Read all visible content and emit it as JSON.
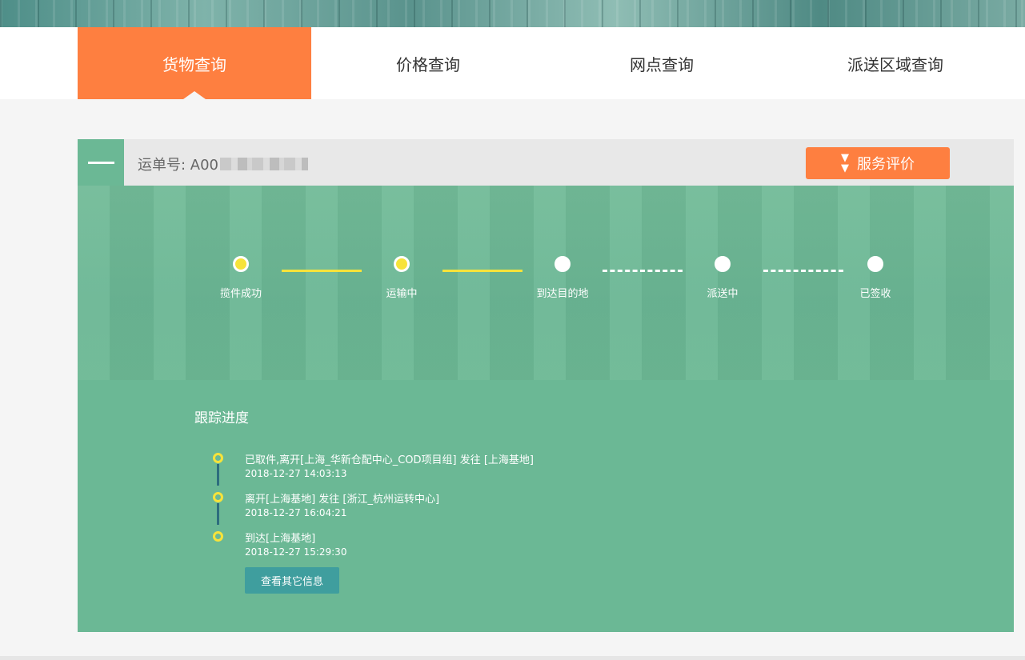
{
  "nav": {
    "tabs": [
      {
        "label": "货物查询",
        "active": true
      },
      {
        "label": "价格查询",
        "active": false
      },
      {
        "label": "网点查询",
        "active": false
      },
      {
        "label": "派送区域查询",
        "active": false
      }
    ]
  },
  "waybill": {
    "label": "运单号: A00",
    "rate_button": "服务评价",
    "rate_icon": "double-chevron-down-icon"
  },
  "progress": {
    "steps": [
      {
        "label": "揽件成功",
        "done": true
      },
      {
        "label": "运输中",
        "done": true
      },
      {
        "label": "到达目的地",
        "done": false
      },
      {
        "label": "派送中",
        "done": false
      },
      {
        "label": "已签收",
        "done": false
      }
    ]
  },
  "tracking": {
    "title": "跟踪进度",
    "entries": [
      {
        "text": "已取件,离开[上海_华新仓配中心_COD项目组] 发往 [上海基地]",
        "time": "2018-12-27 14:03:13"
      },
      {
        "text": "离开[上海基地] 发往 [浙江_杭州运转中心]",
        "time": "2018-12-27 16:04:21"
      },
      {
        "text": "到达[上海基地]",
        "time": "2018-12-27 15:29:30"
      }
    ],
    "more_button": "查看其它信息"
  },
  "colors": {
    "accent": "#fe7f40",
    "panel": "#6bb895",
    "done": "#f7e33a",
    "button": "#3f9e9e"
  }
}
